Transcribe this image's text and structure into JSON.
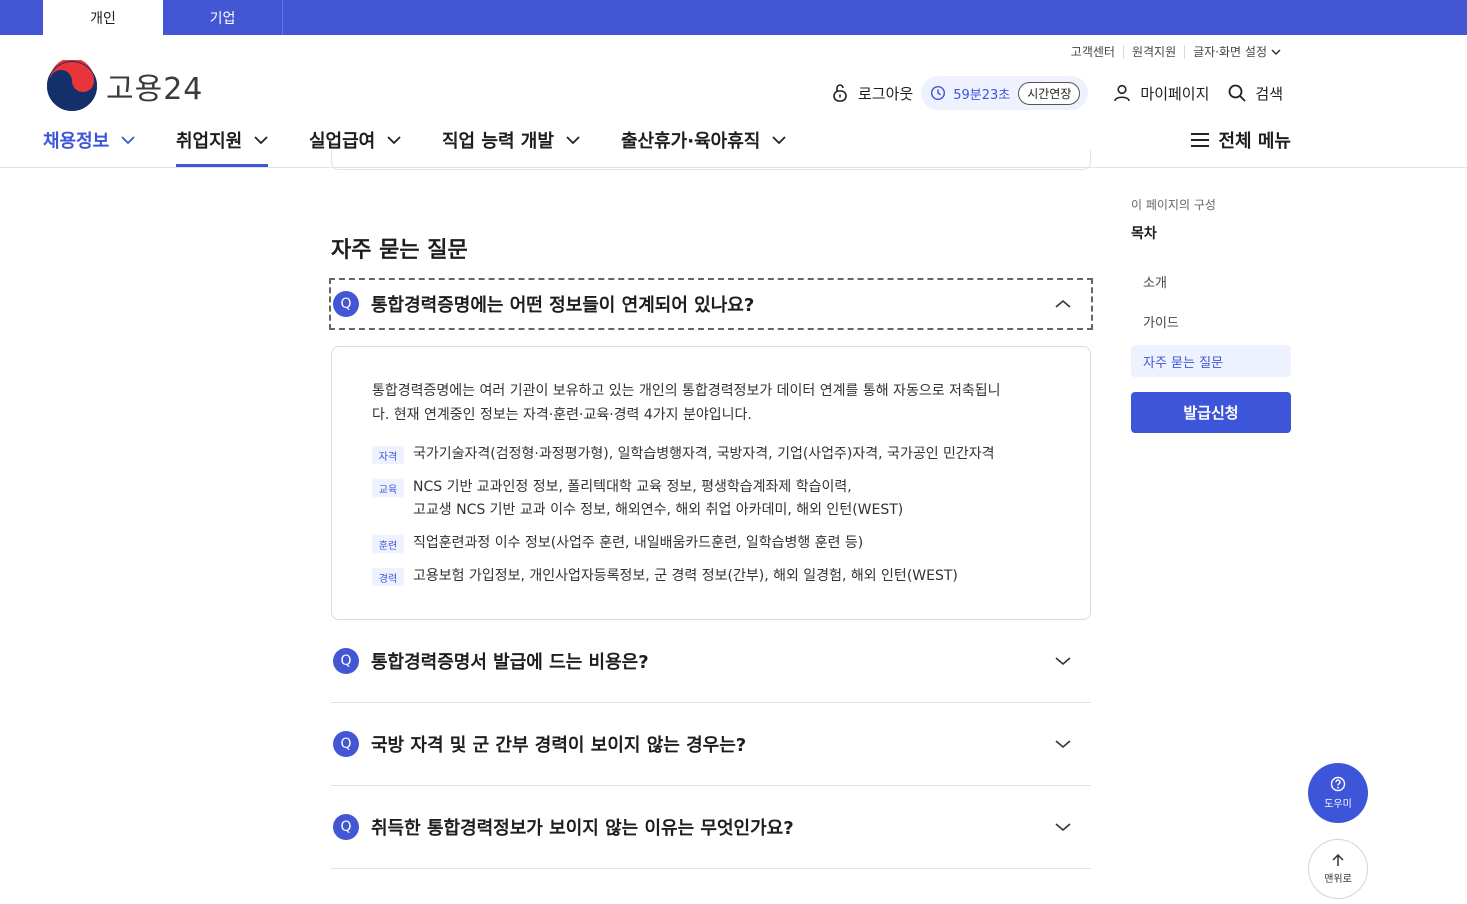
{
  "top_tabs": {
    "personal": "개인",
    "corporate": "기업"
  },
  "logo": {
    "text": "고용24"
  },
  "utility": {
    "customer_center": "고객센터",
    "remote_support": "원격지원",
    "display_settings": "글자·화면 설정"
  },
  "header": {
    "logout": "로그아웃",
    "timer": "59분23초",
    "extend": "시간연장",
    "mypage": "마이페이지",
    "search": "검색"
  },
  "nav": {
    "items": [
      {
        "label": "채용정보"
      },
      {
        "label": "취업지원"
      },
      {
        "label": "실업급여"
      },
      {
        "label": "직업 능력 개발"
      },
      {
        "label": "출산휴가·육아휴직"
      }
    ],
    "all_menu": "전체 메뉴"
  },
  "faq": {
    "title": "자주 묻는 질문",
    "badge": "Q",
    "questions": [
      {
        "text": "통합경력증명에는 어떤 정보들이 연계되어 있나요?"
      },
      {
        "text": "통합경력증명서 발급에 드는 비용은?"
      },
      {
        "text": "국방 자격 및 군 간부 경력이 보이지 않는 경우는?"
      },
      {
        "text": "취득한 통합경력정보가 보이지 않는 이유는 무엇인가요?"
      }
    ],
    "answer": {
      "intro_line1": "통합경력증명에는 여러 기관이 보유하고 있는 개인의 통합경력정보가 데이터 연계를 통해 자동으로 저축됩니",
      "intro_line2": "다. 현재 연계중인 정보는 자격·훈련·교육·경력 4가지 분야입니다.",
      "rows": [
        {
          "tag": "자격",
          "line1": "국가기술자격(검정형·과정평가형), 일학습병행자격, 국방자격, 기업(사업주)자격, 국가공인 민간자격",
          "line2": ""
        },
        {
          "tag": "교육",
          "line1": "NCS 기반 교과인정 정보, 폴리텍대학 교육 정보, 평생학습계좌제 학습이력,",
          "line2": "고교생 NCS 기반 교과 이수 정보, 해외연수, 해외 취업 아카데미, 해외 인턴(WEST)"
        },
        {
          "tag": "훈련",
          "line1": "직업훈련과정 이수 정보(사업주 훈련, 내일배움카드훈련, 일학습병행 훈련 등)",
          "line2": ""
        },
        {
          "tag": "경력",
          "line1": "고용보험 가입정보, 개인사업자등록정보, 군 경력 정보(간부), 해외 일경험, 해외 인턴(WEST)",
          "line2": ""
        }
      ]
    }
  },
  "aside": {
    "caption": "이 페이지의 구성",
    "toc_title": "목차",
    "toc": [
      {
        "label": "소개"
      },
      {
        "label": "가이드"
      },
      {
        "label": "자주 묻는 질문"
      }
    ],
    "apply_button": "발급신청"
  },
  "floating": {
    "help": "도우미",
    "top": "맨위로"
  },
  "colors": {
    "primary": "#3d55d8",
    "topbar": "#4356d4",
    "light_accent": "#eef2ff"
  }
}
